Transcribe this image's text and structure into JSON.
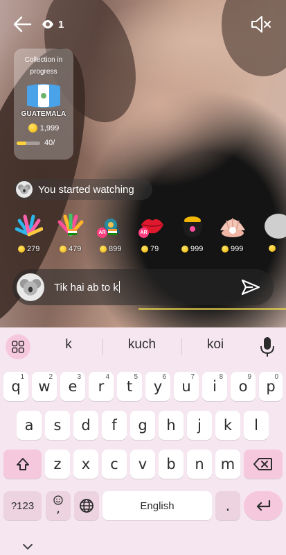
{
  "stream": {
    "viewer_count": "1",
    "collection": {
      "title_line1": "Collection in",
      "title_line2": "progress",
      "country": "GUATEMALA",
      "coins": "1,999",
      "progress_text": "40/",
      "progress_fraction": 0.4
    },
    "watch_message": "You started watching",
    "gifts": [
      {
        "price": "279",
        "icon": "colorful-burst-gift",
        "badge": ""
      },
      {
        "price": "479",
        "icon": "rainbow-burst-flag-gift",
        "badge": ""
      },
      {
        "price": "899",
        "icon": "peacock-crown-gift",
        "badge": "AR"
      },
      {
        "price": "79",
        "icon": "red-lips-gift",
        "badge": "AR"
      },
      {
        "price": "999",
        "icon": "gold-pot-gift",
        "badge": ""
      },
      {
        "price": "999",
        "icon": "pearl-shell-gift",
        "badge": ""
      }
    ],
    "comment": {
      "text": "Tik hai ab to k"
    }
  },
  "keyboard": {
    "suggestions": [
      "k",
      "kuch",
      "koi"
    ],
    "row1": [
      {
        "key": "q",
        "hint": "1"
      },
      {
        "key": "w",
        "hint": "2"
      },
      {
        "key": "e",
        "hint": "3"
      },
      {
        "key": "r",
        "hint": "4"
      },
      {
        "key": "t",
        "hint": "5"
      },
      {
        "key": "y",
        "hint": "6"
      },
      {
        "key": "u",
        "hint": "7"
      },
      {
        "key": "i",
        "hint": "8"
      },
      {
        "key": "o",
        "hint": "9"
      },
      {
        "key": "p",
        "hint": "0"
      }
    ],
    "row2": [
      "a",
      "s",
      "d",
      "f",
      "g",
      "h",
      "j",
      "k",
      "l"
    ],
    "row3": [
      "z",
      "x",
      "c",
      "v",
      "b",
      "n",
      "m"
    ],
    "symbols_label": "?123",
    "comma_label": ",",
    "period_label": ".",
    "space_label": "English"
  }
}
